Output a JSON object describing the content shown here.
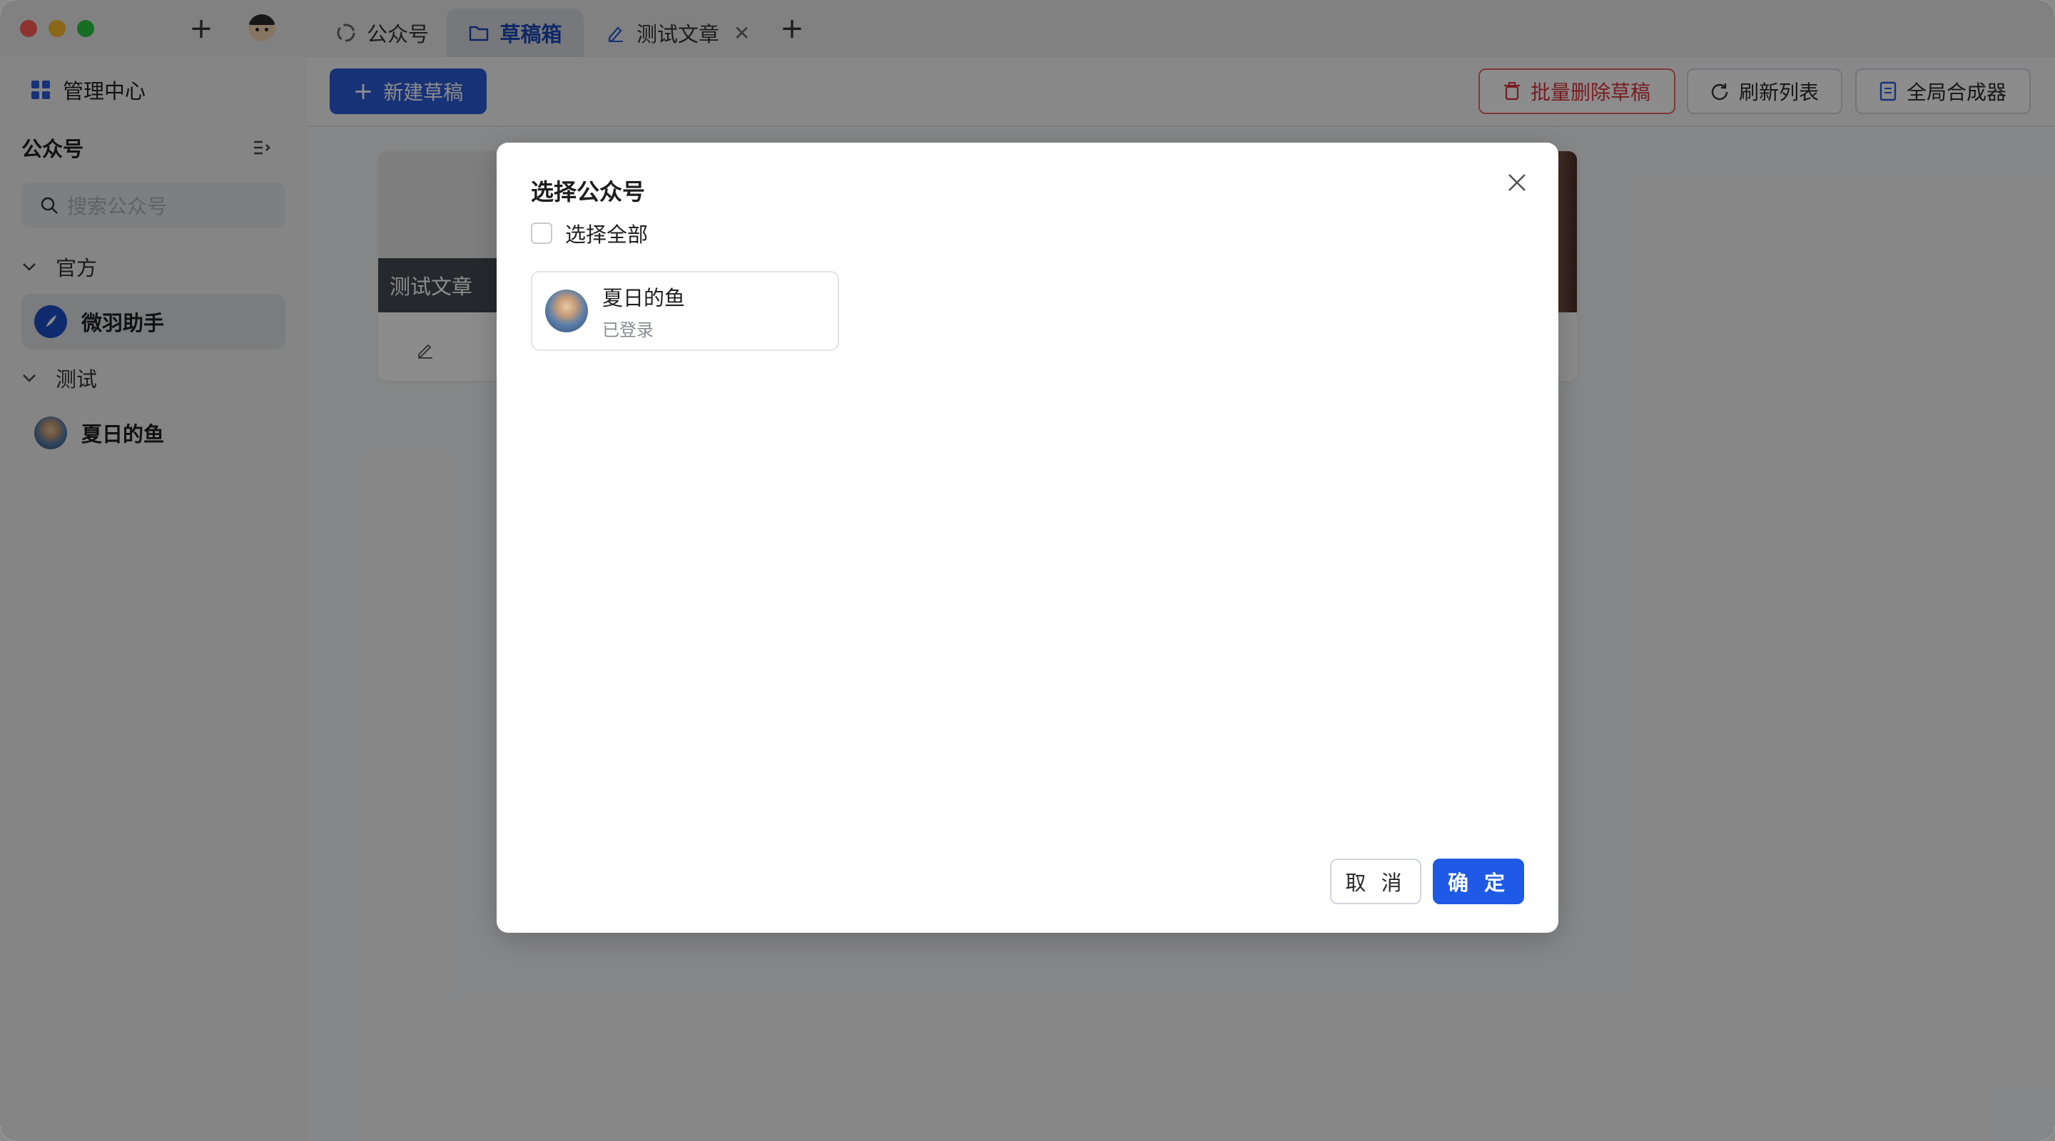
{
  "tabs": [
    {
      "label": "公众号",
      "icon": "wechat-logo-icon",
      "active": false
    },
    {
      "label": "草稿箱",
      "icon": "folder-icon",
      "active": true
    },
    {
      "label": "测试文章",
      "icon": "pen-icon",
      "active": false,
      "closable": true
    }
  ],
  "sidebar": {
    "management": "管理中心",
    "section_title": "公众号",
    "search_placeholder": "搜索公众号",
    "groups": [
      {
        "name": "官方",
        "accounts": [
          {
            "name": "微羽助手",
            "selected": true
          }
        ]
      },
      {
        "name": "测试",
        "accounts": [
          {
            "name": "夏日的鱼",
            "selected": false
          }
        ]
      }
    ]
  },
  "toolbar": {
    "new_draft": "新建草稿",
    "batch_delete": "批量删除草稿",
    "refresh": "刷新列表",
    "composer": "全局合成器"
  },
  "card": {
    "caption": "测试文章"
  },
  "modal": {
    "title": "选择公众号",
    "select_all": "选择全部",
    "accounts": [
      {
        "name": "夏日的鱼",
        "status": "已登录"
      }
    ],
    "cancel": "取 消",
    "confirm": "确 定"
  },
  "colors": {
    "primary": "#2a5bd7",
    "confirm": "#1e5ae6",
    "danger": "#d9363e"
  }
}
